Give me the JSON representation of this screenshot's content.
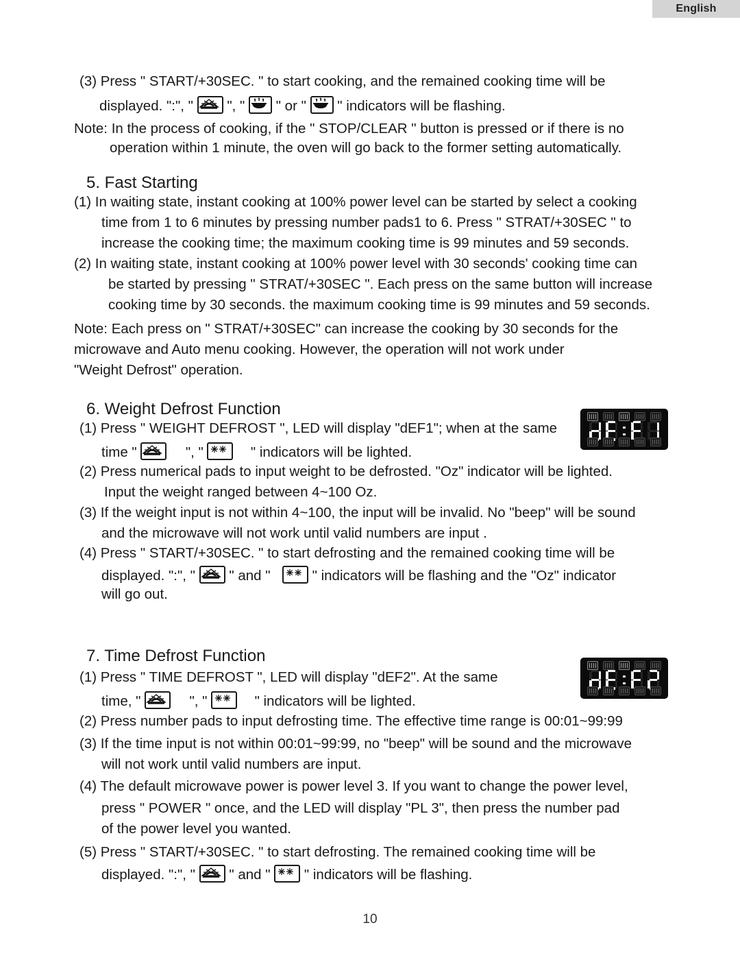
{
  "header": {
    "language_tab": "English"
  },
  "page_number": "10",
  "icons": {
    "microwave_wave": "microwave-wave-icon",
    "steam_bowl": "steam-bowl-icon",
    "defrost_snowflake": "defrost-snowflake-icon"
  },
  "body": {
    "item3": {
      "line1": "(3) Press \" START/+30SEC. \" to start cooking, and the remained cooking time will be",
      "line2_a": "displayed. \":\", \"",
      "line2_b": "\", \"",
      "line2_c": "\" or \"",
      "line2_d": "\" indicators will be flashing."
    },
    "note1": {
      "line1": "Note: In the process of cooking, if the \" STOP/CLEAR \" button is pressed  or if there is no",
      "line2": "operation within 1 minute,  the oven will go back to the former setting automatically."
    },
    "section5": {
      "heading": "5. Fast Starting",
      "item1_line1": "(1) In waiting state, instant cooking at 100% power level can be started by select a cooking",
      "item1_line2": "time from 1 to 6 minutes by pressing number pads1 to 6. Press \" STRAT/+30SEC \"  to",
      "item1_line3": "increase the cooking time; the maximum cooking time is 99 minutes and 59 seconds.",
      "item2_line1": "(2) In waiting state, instant cooking at 100% power level with 30 seconds' cooking time can",
      "item2_line2": "be started by pressing \" STRAT/+30SEC \". Each press on the same button will increase",
      "item2_line3": "cooking time by 30 seconds. the maximum cooking time is 99 minutes and 59 seconds.",
      "note_line1": "Note: Each press on \" STRAT/+30SEC\" can increase the cooking by 30 seconds for the",
      "note_line2": "microwave and Auto menu cooking.  However, the operation will not work under",
      "note_line3": "\"Weight Defrost\" operation."
    },
    "section6": {
      "heading": "6. Weight Defrost Function",
      "item1_line1": "(1) Press \" WEIGHT DEFROST \", LED will display \"dEF1\"; when at the same",
      "item1_line2_a": "time \"",
      "item1_line2_b": "\", \"",
      "item1_line2_c": "\" indicators will be lighted.",
      "item2_line1": "(2) Press numerical pads to input weight to be defrosted. \"Oz\" indicator will be  lighted.",
      "item2_line2": "Input the weight ranged between  4~100 Oz.",
      "item3_line1": "(3) If the weight input  is not within 4~100, the input will be invalid. No \"beep\" will be sound",
      "item3_line2": "and the microwave will not work until valid numbers are input .",
      "item4_line1": "(4) Press \" START/+30SEC. \" to start defrosting and the remained cooking time will be",
      "item4_line2_a": "displayed. \":\", \"",
      "item4_line2_b": "\" and \"",
      "item4_line2_c": "\" indicators will be flashing and the \"Oz\" indicator",
      "item4_line3": "will go out."
    },
    "section7": {
      "heading": "7. Time Defrost Function",
      "item1_line1": "(1) Press \" TIME DEFROST \",  LED will display \"dEF2\". At the same",
      "item1_line2_a": "time, \"",
      "item1_line2_b": "\", \"",
      "item1_line2_c": "\" indicators will be lighted.",
      "item2_line1": "(2) Press number pads to input defrosting time. The effective time range is 00:01~99:99",
      "item3_line1": "(3) If the time input is not within 00:01~99:99, no \"beep\" will be sound and the microwave",
      "item3_line2": "will not work until valid numbers are input.",
      "item4_line1": "(4) The default microwave power is power level 3. If you want to change the power level,",
      "item4_line2": "press \" POWER \" once, and the LED will display \"PL 3\", then press the number pad",
      "item4_line3": "of  the power level you wanted.",
      "item5_line1": "(5) Press \" START/+30SEC. \" to start defrosting. The remained cooking time will be",
      "item5_line2_a": "displayed. \":\", \"",
      "item5_line2_b": "\" and \"",
      "item5_line2_c": "\" indicators will be flashing."
    }
  },
  "led_displays": [
    {
      "name": "weight-defrost-led-display",
      "reading": "dEF1",
      "digits": [
        "d",
        "E",
        "F",
        "1"
      ],
      "colon": true,
      "top_indicator_count": 5,
      "bottom_indicator_count": 5
    },
    {
      "name": "time-defrost-led-display",
      "reading": "dEF2",
      "digits": [
        "d",
        "E",
        "F",
        "2"
      ],
      "colon": true,
      "top_indicator_count": 5,
      "bottom_indicator_count": 5
    }
  ]
}
